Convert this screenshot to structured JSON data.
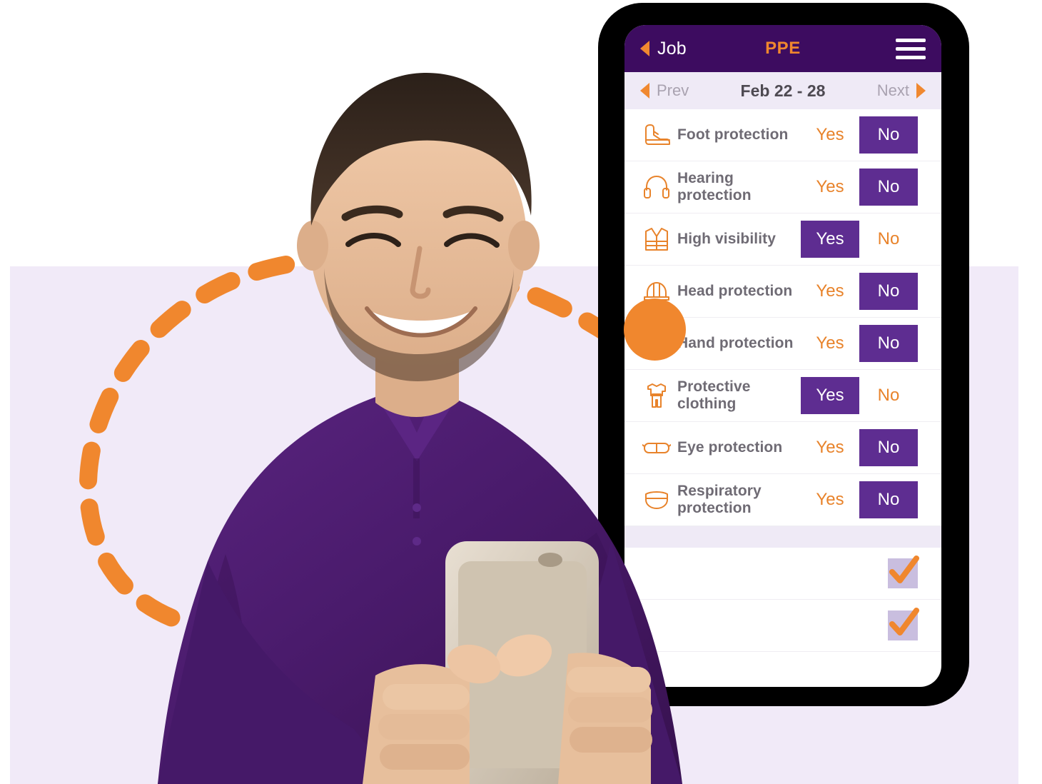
{
  "colors": {
    "brand_purple_dark": "#3D0C60",
    "brand_purple": "#5E2D91",
    "brand_orange": "#F0872E",
    "lavender_bg": "#F1EAF8",
    "date_bar_bg": "#EFEAF6",
    "label_gray": "#6F6B74",
    "muted_gray": "#A9A2B0",
    "checkbox_fill": "#C9BEDF",
    "shirt_purple": "#4A1C6E"
  },
  "app": {
    "header": {
      "back_label": "Job",
      "back_icon": "triangle-left-icon",
      "title": "PPE",
      "menu_icon": "hamburger-menu-icon"
    },
    "date_nav": {
      "prev_label": "Prev",
      "prev_icon": "triangle-left-icon",
      "range_label": "Feb 22 - 28",
      "next_label": "Next",
      "next_icon": "triangle-right-icon"
    },
    "option_labels": {
      "yes": "Yes",
      "no": "No"
    },
    "rows": [
      {
        "icon": "boot-icon",
        "label": "Foot protection",
        "selected": "no"
      },
      {
        "icon": "headphones-icon",
        "label": "Hearing protection",
        "selected": "no"
      },
      {
        "icon": "safety-vest-icon",
        "label": "High visibility",
        "selected": "yes"
      },
      {
        "icon": "hard-hat-icon",
        "label": "Head protection",
        "selected": "no"
      },
      {
        "icon": "glove-icon",
        "label": "Hand protection",
        "selected": "no"
      },
      {
        "icon": "protective-clothing-icon",
        "label": "Protective clothing",
        "selected": "yes"
      },
      {
        "icon": "goggles-icon",
        "label": "Eye protection",
        "selected": "no"
      },
      {
        "icon": "respirator-icon",
        "label": "Respiratory protection",
        "selected": "no"
      }
    ],
    "check_rows": [
      {
        "checked": true,
        "icon": "checkmark-icon"
      },
      {
        "checked": true,
        "icon": "checkmark-icon"
      }
    ]
  },
  "decor": {
    "dashed_arc": "dashed-arc-decoration",
    "dot_left": "orange-circle-decoration",
    "dot_right": "orange-circle-decoration",
    "backdrop": "lavender-backdrop-panel",
    "photo": "smiling-man-holding-phone-photo"
  }
}
